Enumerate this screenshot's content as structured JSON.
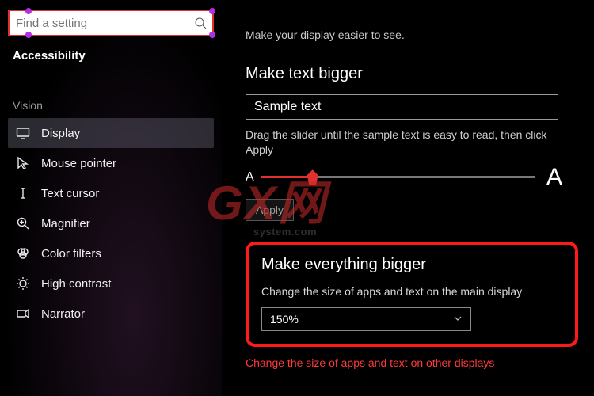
{
  "search": {
    "placeholder": "Find a setting"
  },
  "sidebar": {
    "title": "Accessibility",
    "section": "Vision",
    "items": [
      {
        "label": "Display"
      },
      {
        "label": "Mouse pointer"
      },
      {
        "label": "Text cursor"
      },
      {
        "label": "Magnifier"
      },
      {
        "label": "Color filters"
      },
      {
        "label": "High contrast"
      },
      {
        "label": "Narrator"
      }
    ]
  },
  "main": {
    "subtitle": "Make your display easier to see.",
    "text_bigger": {
      "heading": "Make text bigger",
      "sample": "Sample text",
      "instruction": "Drag the slider until the sample text is easy to read, then click Apply",
      "small_a": "A",
      "big_a": "A",
      "apply": "Apply"
    },
    "everything_bigger": {
      "heading": "Make everything bigger",
      "desc": "Change the size of apps and text on the main display",
      "value": "150%",
      "other": "Change the size of apps and text on other displays"
    }
  },
  "watermark": {
    "main": "GX网",
    "sub": "system.com"
  }
}
